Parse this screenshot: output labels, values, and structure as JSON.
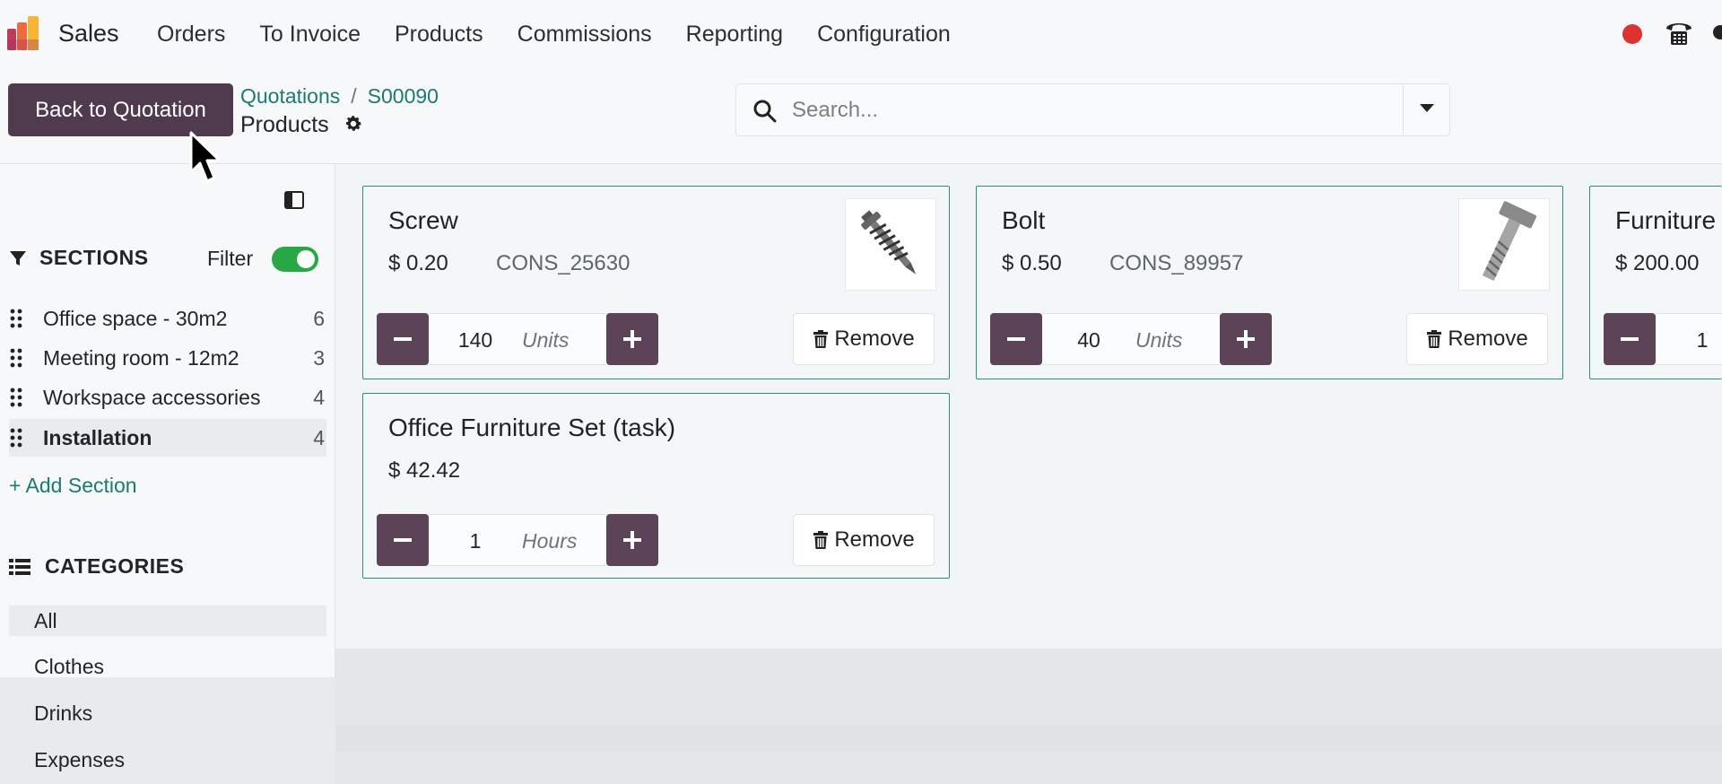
{
  "navbar": {
    "app_name": "Sales",
    "menu": [
      "Orders",
      "To Invoice",
      "Products",
      "Commissions",
      "Reporting",
      "Configuration"
    ]
  },
  "controlbar": {
    "back_label": "Back to Quotation",
    "breadcrumb": [
      "Quotations",
      "S00090"
    ],
    "page_title": "Products",
    "search_placeholder": "Search..."
  },
  "sidebar": {
    "sections_title": "SECTIONS",
    "filter_label": "Filter",
    "filter_on": true,
    "sections": [
      {
        "label": "Office space - 30m2",
        "count": "6"
      },
      {
        "label": "Meeting room - 12m2",
        "count": "3"
      },
      {
        "label": "Workspace accessories",
        "count": "4"
      },
      {
        "label": "Installation",
        "count": "4"
      }
    ],
    "add_section": "+ Add Section",
    "categories_title": "CATEGORIES",
    "categories": [
      "All",
      "Clothes",
      "Drinks",
      "Expenses"
    ]
  },
  "products": [
    {
      "name": "Screw",
      "price": "$ 0.20",
      "code": "CONS_25630",
      "qty": "140",
      "unit": "Units",
      "remove": "Remove"
    },
    {
      "name": "Bolt",
      "price": "$ 0.50",
      "code": "CONS_89957",
      "qty": "40",
      "unit": "Units",
      "remove": "Remove"
    },
    {
      "name": "Furniture",
      "price": "$ 200.00",
      "code": "",
      "qty": "1",
      "unit": "",
      "remove": ""
    },
    {
      "name": "Office Furniture Set (task)",
      "price": "$ 42.42",
      "code": "",
      "qty": "1",
      "unit": "Hours",
      "remove": "Remove"
    }
  ],
  "colors": {
    "accent": "#4f3a4e",
    "link": "#1d7a71",
    "card_border": "#2e8b80",
    "toggle": "#28a745"
  }
}
